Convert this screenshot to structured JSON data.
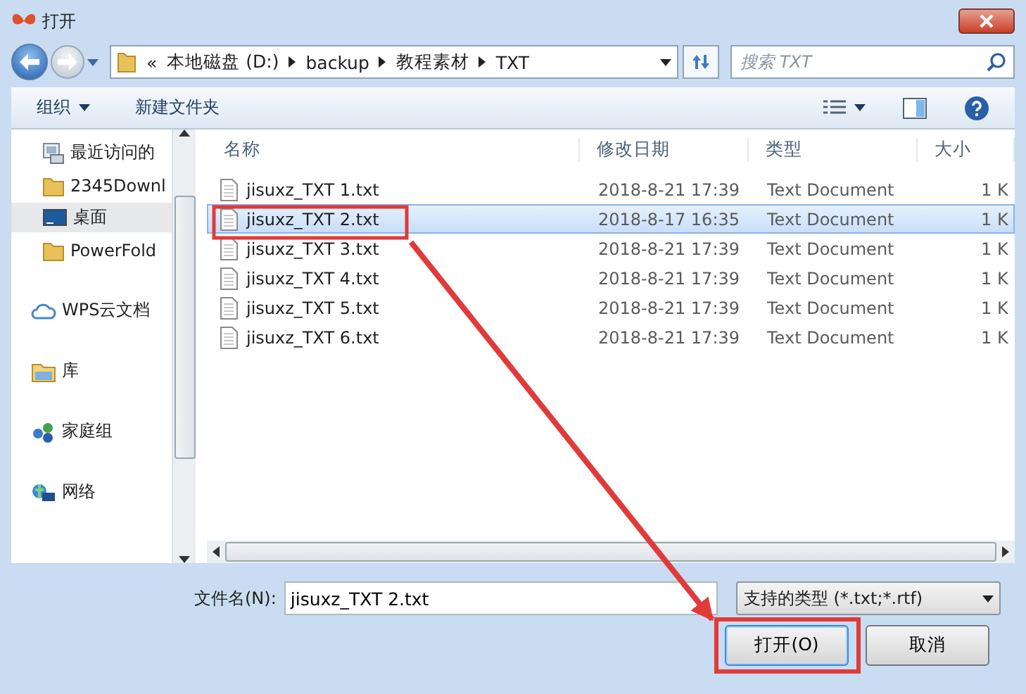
{
  "window": {
    "title": "打开"
  },
  "address": {
    "overflow": "«",
    "segments": [
      "本地磁盘 (D:)",
      "backup",
      "教程素材",
      "TXT"
    ]
  },
  "search": {
    "placeholder": "搜索 TXT"
  },
  "toolbar": {
    "organize": "组织",
    "new_folder": "新建文件夹"
  },
  "sidebar": {
    "sections": [
      {
        "items": [
          {
            "label": "最近访问的",
            "kind": "recent",
            "selected": false
          },
          {
            "label": "2345Downl",
            "kind": "folder",
            "selected": false
          },
          {
            "label": "桌面",
            "kind": "desktop",
            "selected": true
          },
          {
            "label": "PowerFold",
            "kind": "folder",
            "selected": false
          }
        ]
      },
      {
        "items": [
          {
            "label": "WPS云文档",
            "kind": "cloud",
            "selected": false
          }
        ]
      },
      {
        "items": [
          {
            "label": "库",
            "kind": "library",
            "selected": false
          }
        ]
      },
      {
        "items": [
          {
            "label": "家庭组",
            "kind": "homegroup",
            "selected": false
          }
        ]
      },
      {
        "items": [
          {
            "label": "网络",
            "kind": "network",
            "selected": false
          }
        ]
      }
    ]
  },
  "table": {
    "columns": [
      "名称",
      "修改日期",
      "类型",
      "大小"
    ],
    "rows": [
      {
        "name": "jisuxz_TXT 1.txt",
        "modified": "2018-8-21 17:39",
        "type": "Text Document",
        "size": "1 K",
        "selected": false
      },
      {
        "name": "jisuxz_TXT 2.txt",
        "modified": "2018-8-17 16:35",
        "type": "Text Document",
        "size": "1 K",
        "selected": true
      },
      {
        "name": "jisuxz_TXT 3.txt",
        "modified": "2018-8-21 17:39",
        "type": "Text Document",
        "size": "1 K",
        "selected": false
      },
      {
        "name": "jisuxz_TXT 4.txt",
        "modified": "2018-8-21 17:39",
        "type": "Text Document",
        "size": "1 K",
        "selected": false
      },
      {
        "name": "jisuxz_TXT 5.txt",
        "modified": "2018-8-21 17:39",
        "type": "Text Document",
        "size": "1 K",
        "selected": false
      },
      {
        "name": "jisuxz_TXT 6.txt",
        "modified": "2018-8-21 17:39",
        "type": "Text Document",
        "size": "1 K",
        "selected": false
      }
    ]
  },
  "footer": {
    "filename_label": "文件名(N):",
    "filename": "jisuxz_TXT 2.txt",
    "filetype": "支持的类型 (*.txt;*.rtf)",
    "buttons": [
      "打开(O)",
      "取消"
    ]
  }
}
